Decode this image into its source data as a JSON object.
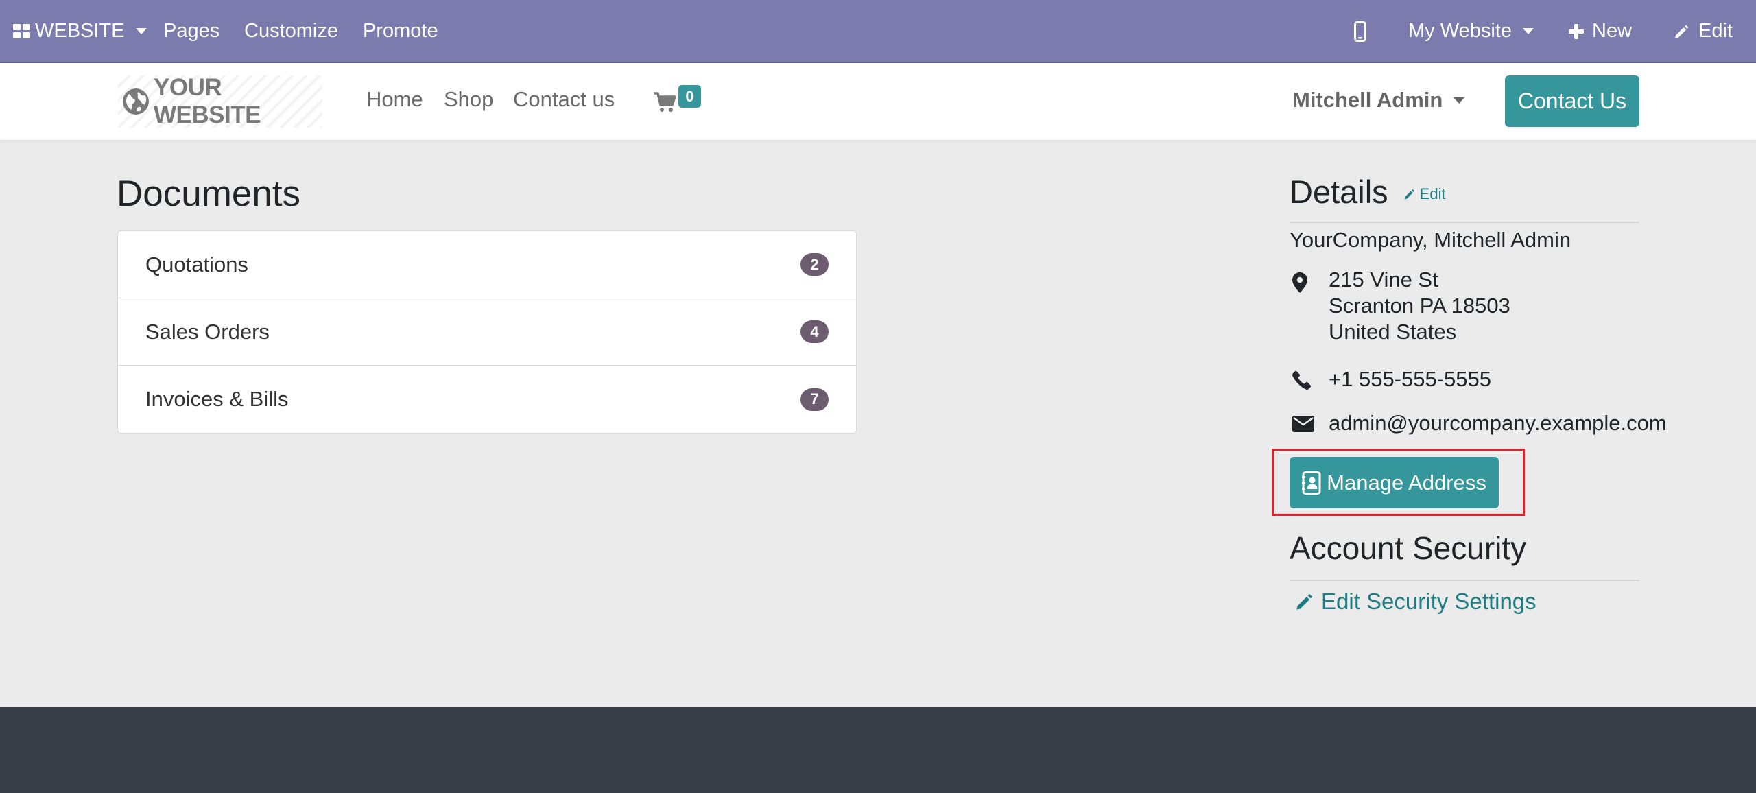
{
  "adminbar": {
    "app_label": "WEBSITE",
    "pages_label": "Pages",
    "customize_label": "Customize",
    "promote_label": "Promote",
    "website_select": "My Website",
    "new_label": "New",
    "edit_label": "Edit"
  },
  "header": {
    "logo_text": "YOUR WEBSITE",
    "nav": {
      "home": "Home",
      "shop": "Shop",
      "contact": "Contact us"
    },
    "cart_count": "0",
    "user_name": "Mitchell Admin",
    "contact_button": "Contact Us"
  },
  "documents": {
    "title": "Documents",
    "items": [
      {
        "label": "Quotations",
        "count": "2"
      },
      {
        "label": "Sales Orders",
        "count": "4"
      },
      {
        "label": "Invoices & Bills",
        "count": "7"
      }
    ]
  },
  "details": {
    "title": "Details",
    "edit_label": "Edit",
    "company": "YourCompany, Mitchell Admin",
    "address": {
      "street": "215 Vine St",
      "city": "Scranton PA 18503",
      "country": "United States"
    },
    "phone": "+1 555-555-5555",
    "email": "admin@yourcompany.example.com",
    "manage_address_label": "Manage Address"
  },
  "security": {
    "title": "Account Security",
    "edit_link": "Edit Security Settings"
  },
  "colors": {
    "adminbar": "#7c7bad",
    "primary": "#35979c",
    "link": "#1c7d82",
    "badge": "#6d5c6f",
    "footer": "#373e47",
    "highlight": "#e8202a"
  }
}
